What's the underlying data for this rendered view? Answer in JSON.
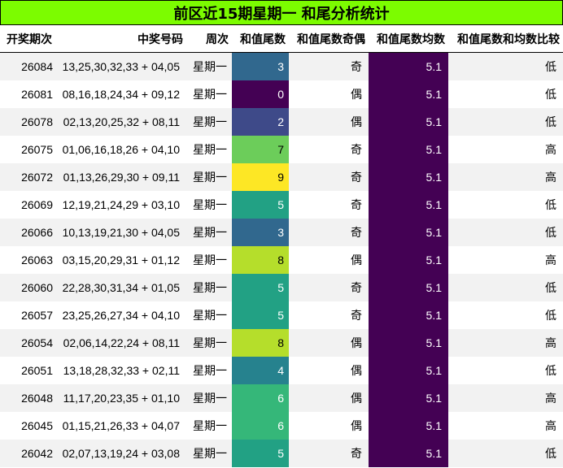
{
  "title": "前区近15期星期一 和尾分析统计",
  "headers": [
    "开奖期次",
    "中奖号码",
    "周次",
    "和值尾数",
    "和值尾数奇偶",
    "和值尾数均数",
    "和值尾数和均数比较"
  ],
  "colors": {
    "title_bg": "#7cfc00",
    "avg_cell": "#440154",
    "zebra": "#f2f2f2"
  },
  "rows": [
    {
      "period": "26084",
      "numbers": "13,25,30,32,33 + 04,05",
      "weekday": "星期一",
      "tail": "3",
      "tail_color": "#31688e",
      "tail_text": "#ffffff",
      "parity": "奇",
      "avg": "5.1",
      "compare": "低"
    },
    {
      "period": "26081",
      "numbers": "08,16,18,24,34 + 09,12",
      "weekday": "星期一",
      "tail": "0",
      "tail_color": "#440154",
      "tail_text": "#ffffff",
      "parity": "偶",
      "avg": "5.1",
      "compare": "低"
    },
    {
      "period": "26078",
      "numbers": "02,13,20,25,32 + 08,11",
      "weekday": "星期一",
      "tail": "2",
      "tail_color": "#3e4a89",
      "tail_text": "#ffffff",
      "parity": "偶",
      "avg": "5.1",
      "compare": "低"
    },
    {
      "period": "26075",
      "numbers": "01,06,16,18,26 + 04,10",
      "weekday": "星期一",
      "tail": "7",
      "tail_color": "#6ccd5a",
      "tail_text": "#000000",
      "parity": "奇",
      "avg": "5.1",
      "compare": "高"
    },
    {
      "period": "26072",
      "numbers": "01,13,26,29,30 + 09,11",
      "weekday": "星期一",
      "tail": "9",
      "tail_color": "#fde725",
      "tail_text": "#000000",
      "parity": "奇",
      "avg": "5.1",
      "compare": "高"
    },
    {
      "period": "26069",
      "numbers": "12,19,21,24,29 + 03,10",
      "weekday": "星期一",
      "tail": "5",
      "tail_color": "#22a184",
      "tail_text": "#ffffff",
      "parity": "奇",
      "avg": "5.1",
      "compare": "低"
    },
    {
      "period": "26066",
      "numbers": "10,13,19,21,30 + 04,05",
      "weekday": "星期一",
      "tail": "3",
      "tail_color": "#31688e",
      "tail_text": "#ffffff",
      "parity": "奇",
      "avg": "5.1",
      "compare": "低"
    },
    {
      "period": "26063",
      "numbers": "03,15,20,29,31 + 01,12",
      "weekday": "星期一",
      "tail": "8",
      "tail_color": "#b5de2b",
      "tail_text": "#000000",
      "parity": "偶",
      "avg": "5.1",
      "compare": "高"
    },
    {
      "period": "26060",
      "numbers": "22,28,30,31,34 + 01,05",
      "weekday": "星期一",
      "tail": "5",
      "tail_color": "#22a184",
      "tail_text": "#ffffff",
      "parity": "奇",
      "avg": "5.1",
      "compare": "低"
    },
    {
      "period": "26057",
      "numbers": "23,25,26,27,34 + 04,10",
      "weekday": "星期一",
      "tail": "5",
      "tail_color": "#22a184",
      "tail_text": "#ffffff",
      "parity": "奇",
      "avg": "5.1",
      "compare": "低"
    },
    {
      "period": "26054",
      "numbers": "02,06,14,22,24 + 08,11",
      "weekday": "星期一",
      "tail": "8",
      "tail_color": "#b5de2b",
      "tail_text": "#000000",
      "parity": "偶",
      "avg": "5.1",
      "compare": "高"
    },
    {
      "period": "26051",
      "numbers": "13,18,28,32,33 + 02,11",
      "weekday": "星期一",
      "tail": "4",
      "tail_color": "#26828e",
      "tail_text": "#ffffff",
      "parity": "偶",
      "avg": "5.1",
      "compare": "低"
    },
    {
      "period": "26048",
      "numbers": "11,17,20,23,35 + 01,10",
      "weekday": "星期一",
      "tail": "6",
      "tail_color": "#35b779",
      "tail_text": "#ffffff",
      "parity": "偶",
      "avg": "5.1",
      "compare": "高"
    },
    {
      "period": "26045",
      "numbers": "01,15,21,26,33 + 04,07",
      "weekday": "星期一",
      "tail": "6",
      "tail_color": "#35b779",
      "tail_text": "#ffffff",
      "parity": "偶",
      "avg": "5.1",
      "compare": "高"
    },
    {
      "period": "26042",
      "numbers": "02,07,13,19,24 + 03,08",
      "weekday": "星期一",
      "tail": "5",
      "tail_color": "#22a184",
      "tail_text": "#ffffff",
      "parity": "奇",
      "avg": "5.1",
      "compare": "低"
    }
  ]
}
